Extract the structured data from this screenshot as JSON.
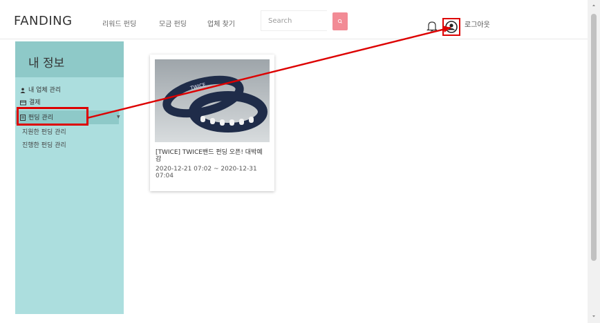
{
  "header": {
    "logo": "FANDING",
    "nav": [
      "리워드 펀딩",
      "모금 펀딩",
      "업체 찾기"
    ],
    "search_placeholder": "Search",
    "logout": "로그아웃"
  },
  "sidebar": {
    "title": "내 정보",
    "items": [
      {
        "label": "내 업체 관리",
        "icon": "user-icon"
      },
      {
        "label": "결제",
        "icon": "card-icon"
      },
      {
        "label": "펀딩 관리",
        "icon": "document-icon"
      }
    ],
    "sub_items": [
      "지원한 펀딩 관리",
      "진행한 펀딩 관리"
    ]
  },
  "funding_card": {
    "title": "[TWICE] TWICE밴드 펀딩 오픈! 대박예감",
    "period": "2020-12-21 07:02 ~ 2020-12-31 07:04",
    "image_text": "TWICE"
  },
  "colors": {
    "sidebar_bg": "#acdede",
    "sidebar_accent": "#8ec9c8",
    "search_button": "#f28b95",
    "highlight": "#dd0000"
  }
}
